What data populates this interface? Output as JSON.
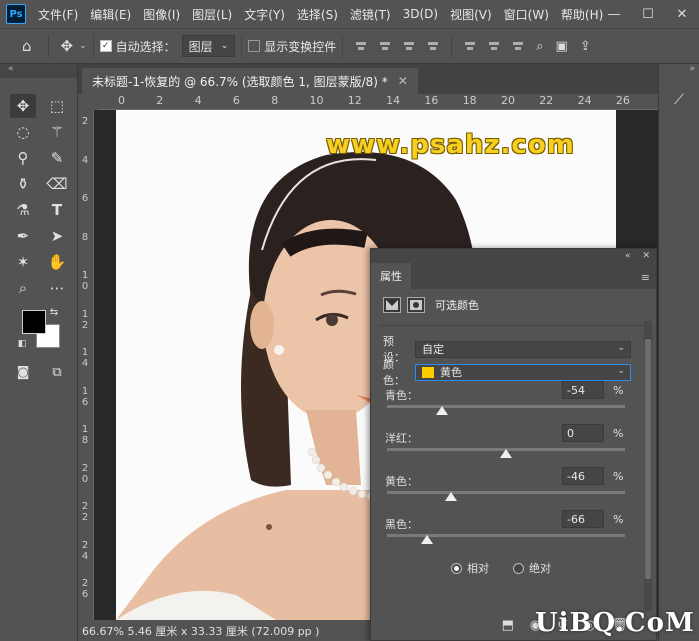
{
  "app": {
    "logo": "Ps"
  },
  "menu": [
    "文件(F)",
    "编辑(E)",
    "图像(I)",
    "图层(L)",
    "文字(Y)",
    "选择(S)",
    "滤镜(T)",
    "3D(D)",
    "视图(V)",
    "窗口(W)",
    "帮助(H)"
  ],
  "options": {
    "auto_select_label": "自动选择：",
    "auto_select_checked": true,
    "auto_select_value": "图层",
    "show_transform_label": "显示变换控件",
    "show_transform_checked": false
  },
  "document": {
    "tab_title": "未标题-1-恢复的 @ 66.7% (选取颜色 1, 图层蒙版/8) *",
    "ruler_h": [
      "0",
      "2",
      "4",
      "6",
      "8",
      "10",
      "12",
      "14",
      "16",
      "18",
      "20",
      "22",
      "24",
      "26"
    ],
    "ruler_v": [
      "2",
      "4",
      "6",
      "8",
      "1\n0",
      "1\n2",
      "1\n4",
      "1\n6",
      "1\n8",
      "2\n0",
      "2\n2",
      "2\n4",
      "2\n6"
    ],
    "watermark": "www.psahz.com"
  },
  "status": {
    "text": "66.67%  5.46 厘米 x 33.33 厘米 (72.009 pp )"
  },
  "properties": {
    "tab": "属性",
    "title": "可选颜色",
    "preset_label": "预设：",
    "preset_value": "自定",
    "color_label": "颜色：",
    "color_value": "黄色",
    "color_swatch": "#ffcc00",
    "sliders": [
      {
        "label": "青色：",
        "value": "-54",
        "unit": "%",
        "position": 0.23
      },
      {
        "label": "洋红：",
        "value": "0",
        "unit": "%",
        "position": 0.5
      },
      {
        "label": "黄色：",
        "value": "-46",
        "unit": "%",
        "position": 0.27
      },
      {
        "label": "黑色：",
        "value": "-66",
        "unit": "%",
        "position": 0.17
      }
    ],
    "mode_relative": "相对",
    "mode_absolute": "绝对",
    "mode_selected": "relative"
  },
  "brand": "UiBQ.CoM"
}
